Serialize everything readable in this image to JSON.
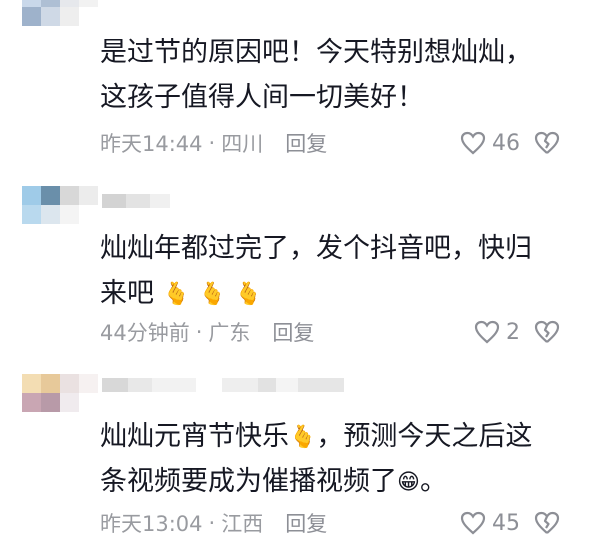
{
  "comments": [
    {
      "text_lines": [
        "是过节的原因吧！今天特别想灿灿，",
        "这孩子值得人间一切美好！"
      ],
      "time": "昨天14:44",
      "location": "四川",
      "reply": "回复",
      "likes": "46",
      "avatar_colors": [
        "#c9d8ea",
        "#aebfd4",
        "#e6e8ec",
        "#f2f2f2",
        "#9eb2cb",
        "#cfd9e6",
        "#eeeeee",
        "#ffffff"
      ]
    },
    {
      "text_lines": [
        "灿灿年都过完了，发个抖音吧，快归",
        "来吧"
      ],
      "time": "44分钟前",
      "location": "广东",
      "reply": "回复",
      "likes": "2",
      "avatar_colors": [
        "#9fcbe8",
        "#6a8faa",
        "#d8d8d8",
        "#ececec",
        "#b9d9ee",
        "#dce6ee",
        "#f4f4f4",
        "#ffffff"
      ]
    },
    {
      "text_lines": [
        "灿灿元宵节快乐",
        "，预测今天之后这",
        "条视频要成为催播视频了",
        "。"
      ],
      "time": "昨天13:04",
      "location": "江西",
      "reply": "回复",
      "likes": "45",
      "avatar_colors": [
        "#f3ddb3",
        "#e7c99a",
        "#eae1e1",
        "#f6f1f1",
        "#c9a6b3",
        "#b89aa8",
        "#f0ebee",
        "#ffffff"
      ]
    }
  ],
  "icons": {
    "heart": "heart-icon",
    "dislike": "broken-heart-icon",
    "emoji_hand": "finger-heart-emoji",
    "emoji_grin": "grinning-emoji"
  },
  "colors": {
    "meta": "#999ba0",
    "text": "#161823",
    "emoji": "#f5b800"
  }
}
